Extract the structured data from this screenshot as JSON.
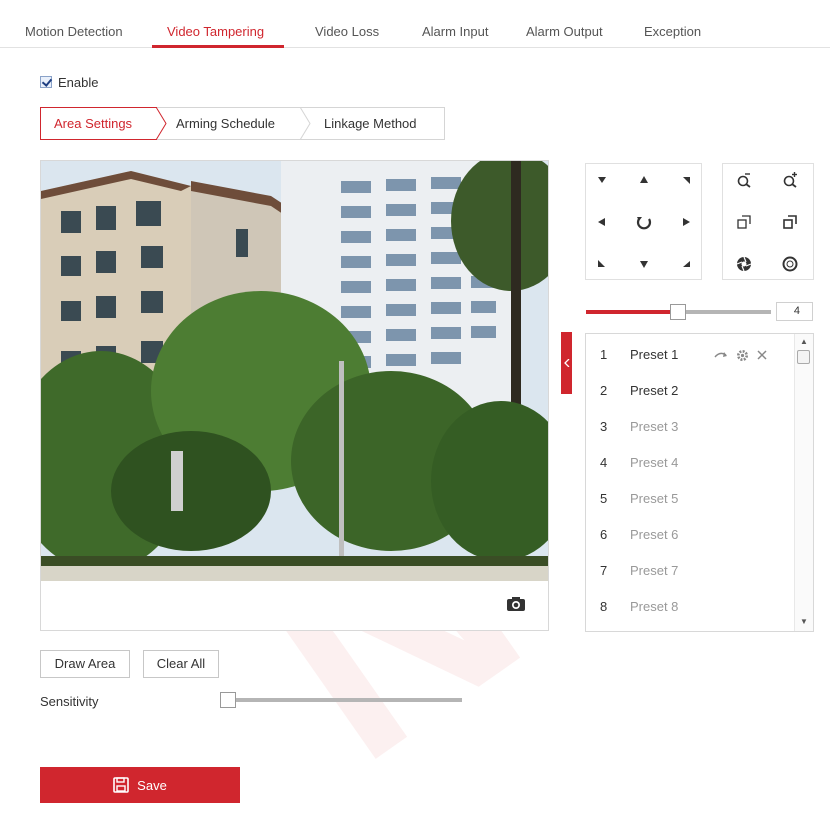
{
  "top_tabs": [
    {
      "label": "Motion Detection"
    },
    {
      "label": "Video Tampering"
    },
    {
      "label": "Video Loss"
    },
    {
      "label": "Alarm Input"
    },
    {
      "label": "Alarm Output"
    },
    {
      "label": "Exception"
    }
  ],
  "active_top_tab": "Video Tampering",
  "enable": {
    "label": "Enable",
    "checked": true
  },
  "sub_tabs": [
    {
      "label": "Area Settings"
    },
    {
      "label": "Arming Schedule"
    },
    {
      "label": "Linkage Method"
    }
  ],
  "active_sub_tab": "Area Settings",
  "ptz": {
    "speed_value": "4",
    "speed_fraction": 0.45,
    "icons": [
      "arrow-up-left-icon",
      "arrow-up-icon",
      "arrow-up-right-icon",
      "arrow-left-icon",
      "auto-scan-icon",
      "arrow-right-icon",
      "arrow-down-left-icon",
      "arrow-down-icon",
      "arrow-down-right-icon",
      "zoom-out-icon",
      "zoom-in-icon",
      "focus-near-icon",
      "focus-far-icon",
      "iris-close-icon",
      "iris-open-icon"
    ]
  },
  "presets": [
    {
      "num": "1",
      "name": "Preset 1"
    },
    {
      "num": "2",
      "name": "Preset 2"
    },
    {
      "num": "3",
      "name": "Preset 3"
    },
    {
      "num": "4",
      "name": "Preset 4"
    },
    {
      "num": "5",
      "name": "Preset 5"
    },
    {
      "num": "6",
      "name": "Preset 6"
    },
    {
      "num": "7",
      "name": "Preset 7"
    },
    {
      "num": "8",
      "name": "Preset 8"
    }
  ],
  "buttons": {
    "draw_area": "Draw Area",
    "clear_all": "Clear All",
    "save": "Save"
  },
  "sensitivity": {
    "label": "Sensitivity",
    "value_fraction": 0.0
  },
  "colors": {
    "accent": "#d0262e",
    "border": "#d8d8d8"
  }
}
